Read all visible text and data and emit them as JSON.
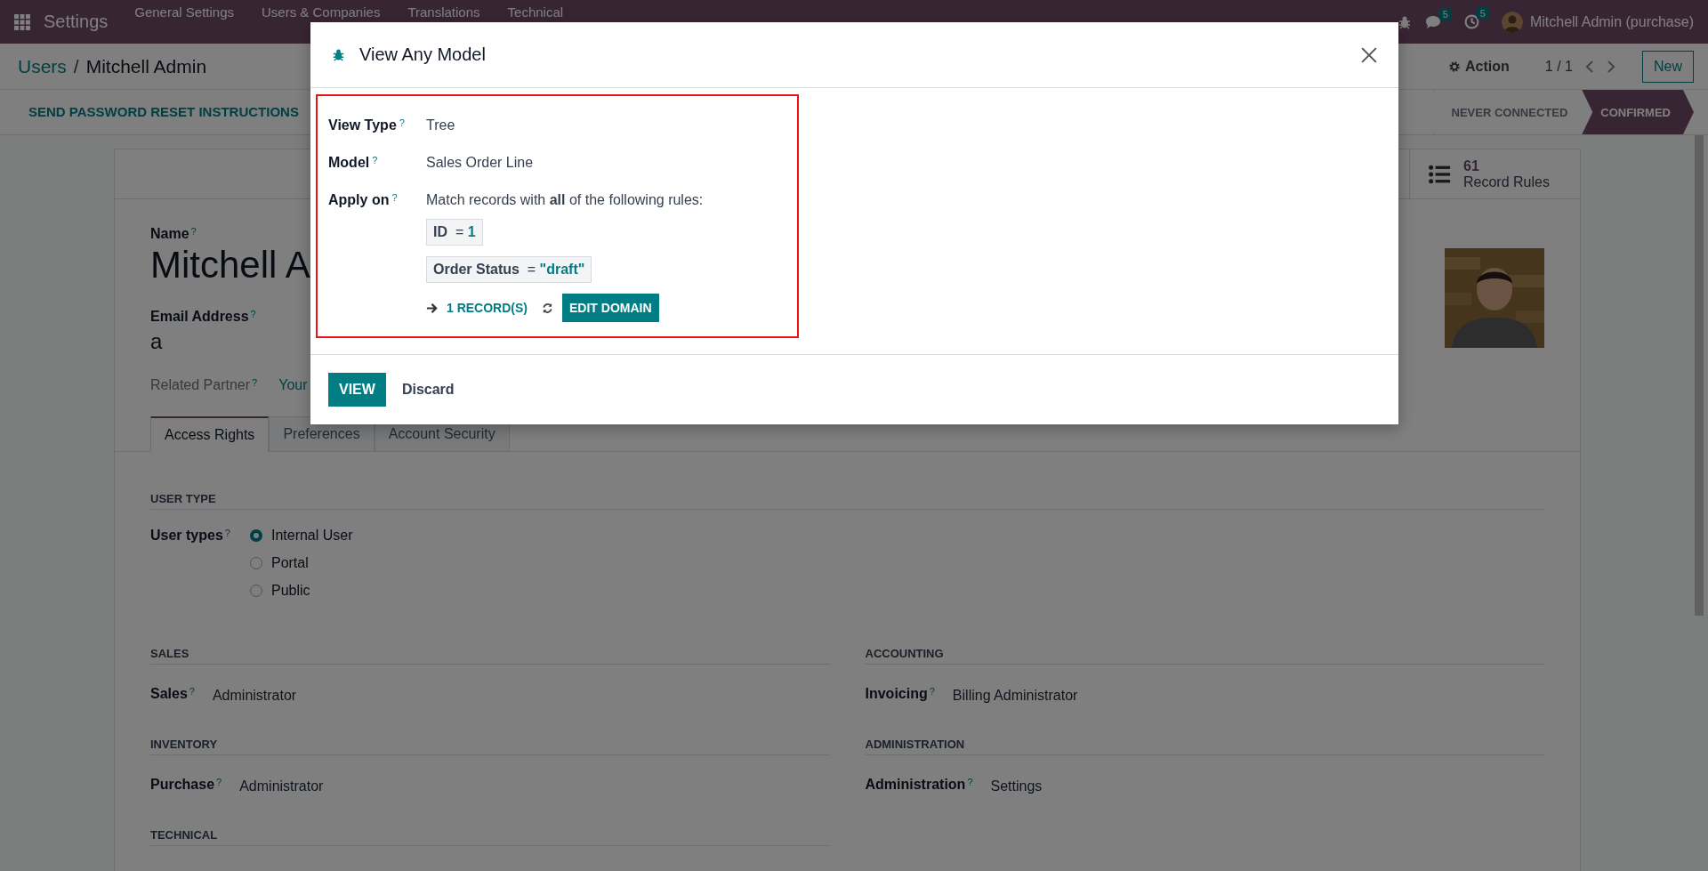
{
  "navbar": {
    "app": "Settings",
    "menus": [
      "General Settings",
      "Users & Companies",
      "Translations",
      "Technical"
    ],
    "chat_count": "5",
    "activity_count": "5",
    "user": "Mitchell Admin (purchase)"
  },
  "breadcrumb": {
    "parent": "Users",
    "separator": "/",
    "current": "Mitchell Admin"
  },
  "control_panel": {
    "action": "Action",
    "pager": "1 / 1",
    "new": "New"
  },
  "header_buttons": [
    "SEND PASSWORD RESET INSTRUCTIONS"
  ],
  "statusbar": [
    {
      "label": "NEVER CONNECTED",
      "selected": false
    },
    {
      "label": "CONFIRMED",
      "selected": true
    }
  ],
  "smart_button": {
    "count": "61",
    "label": "Record Rules"
  },
  "form": {
    "name_label": "Name",
    "name_help": "?",
    "name": "Mitchell A",
    "email_label": "Email Address",
    "email_help": "?",
    "email": "a",
    "partner_label": "Related Partner",
    "partner_help": "?",
    "partner": "Your"
  },
  "tabs": [
    {
      "label": "Access Rights",
      "selected": true
    },
    {
      "label": "Preferences",
      "selected": false
    },
    {
      "label": "Account Security",
      "selected": false
    }
  ],
  "user_type": {
    "title": "USER TYPE",
    "label": "User types",
    "help": "?",
    "options": [
      {
        "label": "Internal User",
        "selected": true
      },
      {
        "label": "Portal",
        "selected": false
      },
      {
        "label": "Public",
        "selected": false
      }
    ]
  },
  "left_sections": [
    {
      "title": "SALES",
      "fields": [
        {
          "label": "Sales",
          "help": "?",
          "value": "Administrator"
        }
      ]
    },
    {
      "title": "INVENTORY",
      "fields": [
        {
          "label": "Purchase",
          "help": "?",
          "value": "Administrator"
        }
      ]
    },
    {
      "title": "TECHNICAL"
    }
  ],
  "right_sections": [
    {
      "title": "ACCOUNTING",
      "fields": [
        {
          "label": "Invoicing",
          "help": "?",
          "value": "Billing Administrator"
        }
      ]
    },
    {
      "title": "ADMINISTRATION",
      "fields": [
        {
          "label": "Administration",
          "help": "?",
          "value": "Settings"
        }
      ]
    }
  ],
  "dialog": {
    "title": "View Any Model",
    "fields": [
      {
        "label": "View Type",
        "help": "?",
        "value": "Tree"
      },
      {
        "label": "Model",
        "help": "?",
        "value": "Sales Order Line"
      }
    ],
    "apply_label": "Apply on",
    "apply_help": "?",
    "domain_intro": "Match records with **all** of the following rules:",
    "rules": [
      {
        "field": "ID",
        "operator": "=",
        "value": "1"
      },
      {
        "field": "Order Status",
        "operator": "=",
        "value": "\"draft\""
      }
    ],
    "records": "1 RECORD(S)",
    "edit": "EDIT DOMAIN",
    "primary": "VIEW",
    "secondary": "Discard"
  }
}
